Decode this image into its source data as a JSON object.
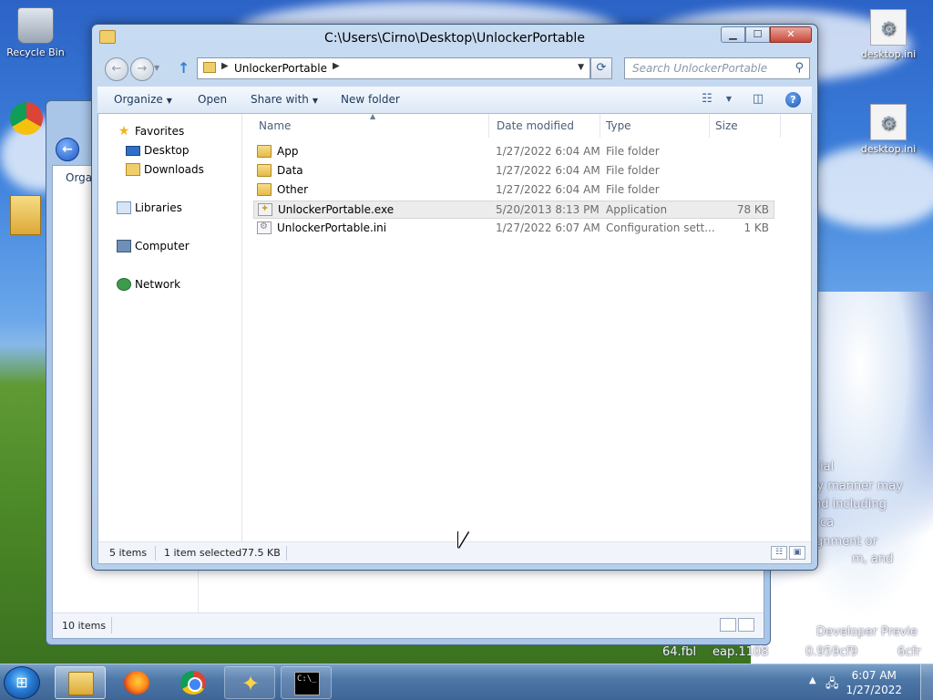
{
  "desktop": {
    "icons": [
      {
        "label": "Recycle Bin"
      },
      {
        "label": "desktop.ini"
      },
      {
        "label": "desktop.ini"
      }
    ],
    "background_text": [
      "ial",
      "ny manner may",
      "nd including",
      "ca",
      "gnment or",
      "m, and",
      "Developer Previe",
      "64.fbl",
      "eap.1108",
      "0.959cf9",
      "6cfr"
    ]
  },
  "background_window": {
    "toolbar_partial": "Orga",
    "status": "10 items"
  },
  "window": {
    "title": "C:\\Users\\Cirno\\Desktop\\UnlockerPortable",
    "address": {
      "crumb": "UnlockerPortable"
    },
    "search": {
      "placeholder": "Search UnlockerPortable"
    },
    "toolbar": {
      "organize": "Organize",
      "open": "Open",
      "share_with": "Share with",
      "new_folder": "New folder"
    },
    "nav": {
      "favorites": "Favorites",
      "desktop": "Desktop",
      "downloads": "Downloads",
      "libraries": "Libraries",
      "computer": "Computer",
      "network": "Network"
    },
    "columns": {
      "name": "Name",
      "date": "Date modified",
      "type": "Type",
      "size": "Size"
    },
    "files": [
      {
        "name": "App",
        "date": "1/27/2022 6:04 AM",
        "type": "File folder",
        "size": "",
        "icon": "folder-icon"
      },
      {
        "name": "Data",
        "date": "1/27/2022 6:04 AM",
        "type": "File folder",
        "size": "",
        "icon": "folder-icon"
      },
      {
        "name": "Other",
        "date": "1/27/2022 6:04 AM",
        "type": "File folder",
        "size": "",
        "icon": "folder-icon"
      },
      {
        "name": "UnlockerPortable.exe",
        "date": "5/20/2013 8:13 PM",
        "type": "Application",
        "size": "78 KB",
        "icon": "application-icon",
        "selected": true
      },
      {
        "name": "UnlockerPortable.ini",
        "date": "1/27/2022 6:07 AM",
        "type": "Configuration sett...",
        "size": "1 KB",
        "icon": "config-file-icon"
      }
    ],
    "status": {
      "count": "5 items",
      "selected": "1 item selected",
      "size": "77.5 KB"
    }
  },
  "taskbar": {
    "clock_time": "6:07 AM",
    "clock_date": "1/27/2022",
    "apps": [
      "windows-explorer",
      "firefox",
      "chrome",
      "magic-wand-app",
      "command-prompt"
    ]
  }
}
